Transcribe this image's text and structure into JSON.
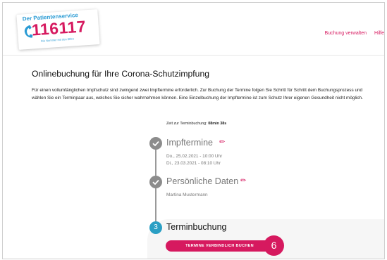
{
  "header": {
    "logo_top": "Der Patientenservice",
    "logo_number": "116117",
    "logo_sub": "Die Nummer mit den Elfen",
    "nav": [
      "Buchung verwalten",
      "Hilfe"
    ]
  },
  "main": {
    "title": "Onlinebuchung für Ihre Corona-Schutzimpfung",
    "intro": "Für einen vollumfänglichen Impfschutz sind zwingend zwei Impftermine erforderlich. Zur Buchung der Termine folgen Sie Schritt für Schritt dem Buchungsprozess und wählen Sie ein Terminpaar aus, welches Sie sicher wahrnehmen können. Eine Einzelbuchung der Impftermine ist zum Schutz Ihrer eigenen Gesundheit nicht möglich.",
    "timer_label": "Zeit zur Terminbuchung:",
    "timer_value": "08min 38s"
  },
  "steps": [
    {
      "status": "done",
      "icon": "check-icon",
      "title": "Impftermine",
      "details": [
        "Do., 25.02.2021 - 10:00 Uhr",
        "Di., 23.03.2021 - 08:10 Uhr"
      ]
    },
    {
      "status": "done",
      "icon": "check-icon",
      "title": "Persönliche Daten",
      "details": [
        "Martina Mustermann"
      ]
    },
    {
      "status": "active",
      "number": "3",
      "title": "Terminbuchung"
    }
  ],
  "cta": {
    "label": "TERMINE VERBINDLICH BUCHEN"
  },
  "annotation": {
    "badge": "6"
  },
  "colors": {
    "brand": "#d6195f",
    "accent": "#2a9fc4",
    "logo_blue": "#2a9bd4",
    "step_done": "#8c8c8c"
  }
}
